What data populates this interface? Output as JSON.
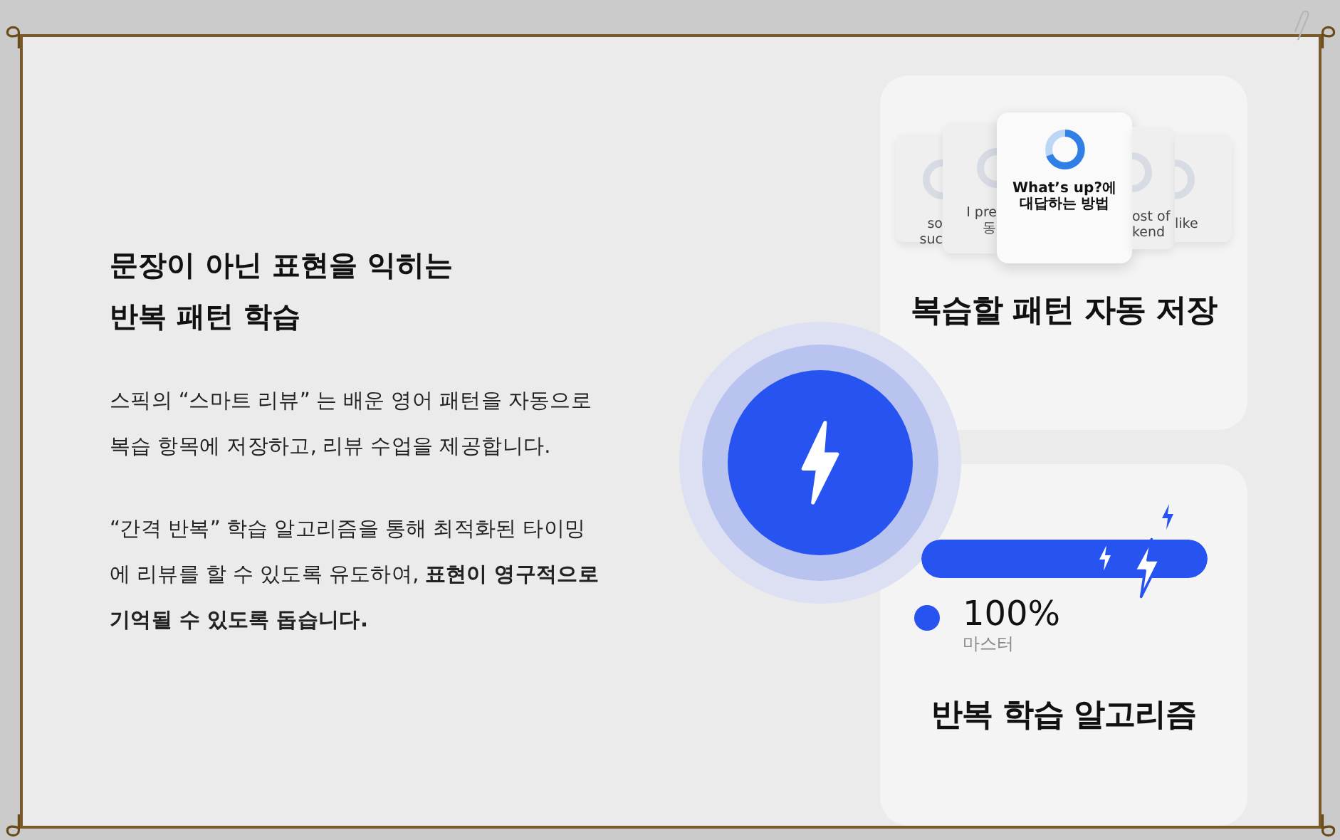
{
  "intro": {
    "title_lines": [
      "문장이 아닌 표현을 익히는",
      "반복 패턴 학습"
    ],
    "paragraphs": [
      "스픽의 “스마트 리뷰” 는 배운 영어 패턴을 자동으로\n복습 항목에 저장하고, 리뷰 수업을 제공합니다.",
      "“간격 반복” 학습 알고리즘을 통해 최적화된 타이밍\n에 리뷰를 할 수 있도록 유도하여, **표현이 영구적으로**\n**기억될 수 있도록 돕습니다.**"
    ]
  },
  "features": [
    {
      "kind": "cards",
      "title": "복습할 패턴 자동 저장",
      "cards": [
        {
          "lines": [
            "so",
            "suc"
          ],
          "selected": false
        },
        {
          "lines": [
            "I pre",
            "동"
          ],
          "selected": false
        },
        {
          "lines": [
            "ost of",
            "kend"
          ],
          "selected": false
        },
        {
          "lines": [
            "like"
          ],
          "selected": false
        },
        {
          "lines": [
            "What’s up?에",
            "대답하는 방법"
          ],
          "selected": true
        }
      ]
    },
    {
      "kind": "progress",
      "title": "반복 학습 알고리즘",
      "level": 1,
      "value": "100%",
      "caption": "마스터"
    }
  ]
}
